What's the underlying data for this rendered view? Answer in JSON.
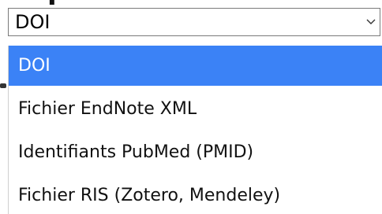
{
  "select": {
    "value": "DOI",
    "arrow_icon": "chevron-down-icon"
  },
  "dropdown": {
    "options": [
      {
        "label": "DOI",
        "selected": true
      },
      {
        "label": "Fichier EndNote XML",
        "selected": false
      },
      {
        "label": "Identifiants PubMed (PMID)",
        "selected": false
      },
      {
        "label": "Fichier RIS (Zotero, Mendeley)",
        "selected": false
      }
    ]
  },
  "colors": {
    "selected_bg": "#3b82f6",
    "selected_text": "#ffffff",
    "border": "#7a7a7a"
  }
}
